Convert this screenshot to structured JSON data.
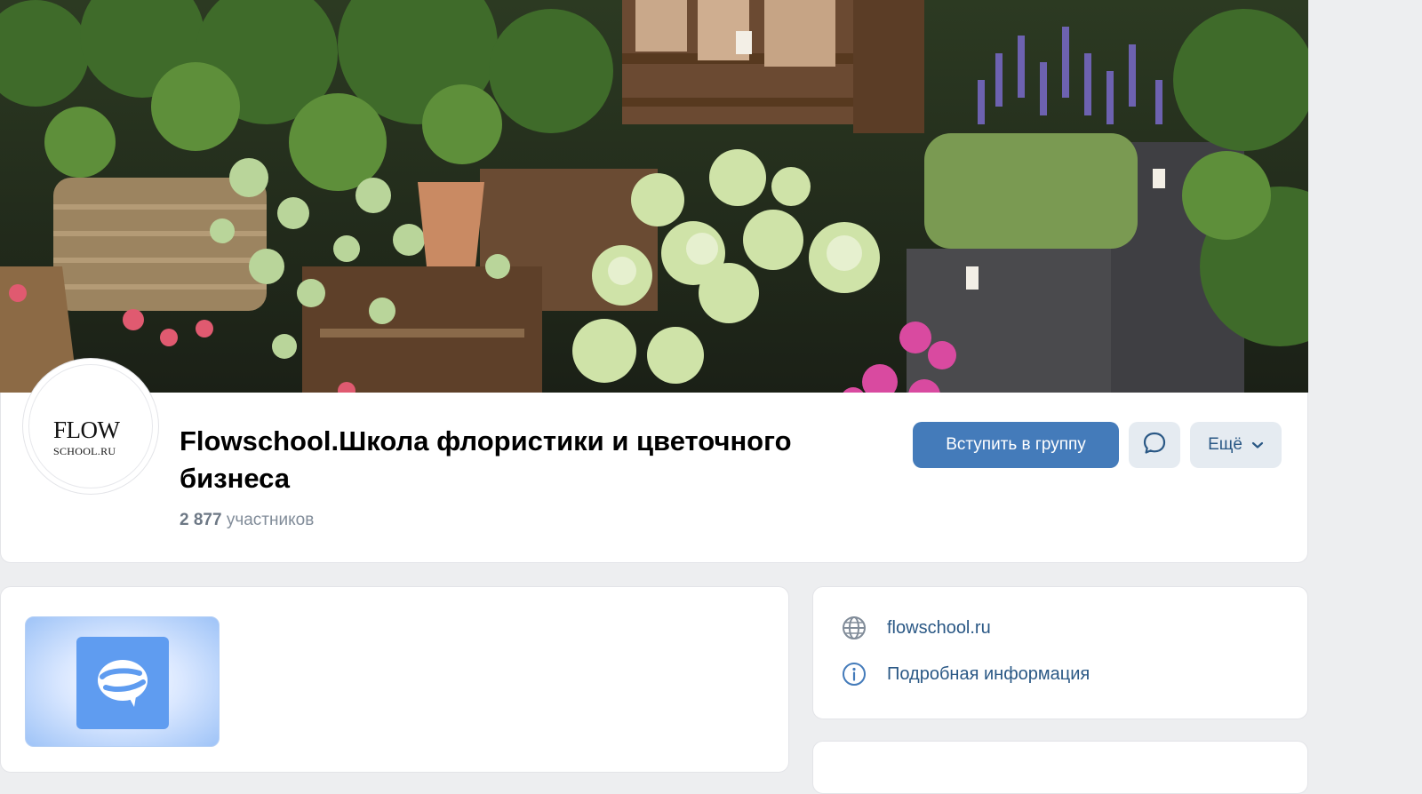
{
  "group": {
    "name": "Flowschool.Школа флористики и цветочного бизнеса",
    "members_count": "2 877",
    "members_label": "участников"
  },
  "logo": {
    "text": "FLOW",
    "site": "SCHOOL.RU"
  },
  "actions": {
    "join_label": "Вступить в группу",
    "more_label": "Ещё"
  },
  "info": {
    "website": "flowschool.ru",
    "details_label": "Подробная информация"
  },
  "colors": {
    "accent": "#447bba",
    "link": "#2a5885",
    "background": "#edeef0"
  },
  "icons": {
    "message": "message-icon",
    "more": "chevron-down-icon",
    "website": "globe-icon",
    "details": "info-icon",
    "app": "chat-app-icon"
  }
}
